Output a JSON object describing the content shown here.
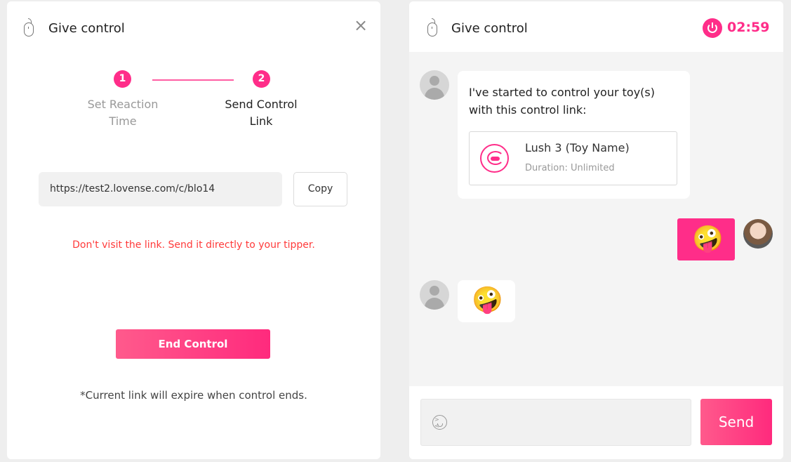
{
  "left_panel": {
    "title": "Give control",
    "close_icon": "×",
    "steps": [
      {
        "number": "1",
        "label": "Set Reaction Time",
        "state": "done"
      },
      {
        "number": "2",
        "label": "Send Control Link",
        "state": "active"
      }
    ],
    "link_url": "https://test2.lovense.com/c/blo14",
    "copy_label": "Copy",
    "warning": "Don't visit the link. Send it directly to your tipper.",
    "end_control_label": "End Control",
    "expire_note": "*Current link will expire when control ends."
  },
  "right_panel": {
    "title": "Give control",
    "timer": "02:59",
    "messages": {
      "incoming_text": "I've started to control your toy(s) with this control link:",
      "toy_name": "Lush 3 (Toy Name)",
      "toy_duration": "Duration: Unlimited",
      "emoji_sent": "🤪",
      "emoji_received": "🤪"
    },
    "input_placeholder": "",
    "send_label": "Send"
  },
  "colors": {
    "accent": "#ff2d89",
    "warning": "#ff3a3a"
  }
}
